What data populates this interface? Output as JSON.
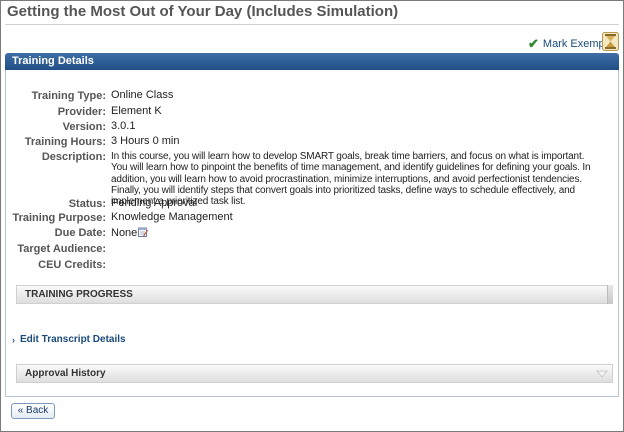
{
  "page": {
    "title": "Getting the Most Out of Your Day (Includes Simulation)"
  },
  "actions": {
    "mark_exempt_label": "Mark Exempt"
  },
  "section": {
    "header": "Training Details"
  },
  "details": [
    {
      "label": "Training Type:",
      "value": "Online Class"
    },
    {
      "label": "Provider:",
      "value": "Element K"
    },
    {
      "label": "Version:",
      "value": "3.0.1"
    },
    {
      "label": "Training Hours:",
      "value": "3 Hours 0 min"
    },
    {
      "label": "Description:",
      "value": "In this course, you will learn how to develop SMART goals, break time barriers, and focus on what is important. You will learn how to pinpoint the benefits of time management, and identify guidelines for defining your goals. In addition, you will learn how to avoid procrastination, minimize interruptions, and avoid perfectionist tendencies. Finally, you will identify steps that convert goals into prioritized tasks, define ways to schedule effectively, and implement a prioritized task list."
    },
    {
      "label": "Status:",
      "value": "Pending Approval"
    },
    {
      "label": "Training Purpose:",
      "value": "Knowledge Management"
    },
    {
      "label": "Due Date:",
      "value": "None"
    },
    {
      "label": "Target Audience:",
      "value": ""
    },
    {
      "label": "CEU Credits:",
      "value": ""
    }
  ],
  "training_progress": {
    "label": "TRAINING PROGRESS"
  },
  "edit_transcript": {
    "label": "Edit Transcript Details"
  },
  "approval_history": {
    "label": "Approval History"
  },
  "back_button": {
    "label": "« Back"
  },
  "icons": {
    "mark_exempt": "check-icon",
    "exempt_status": "hourglass-icon",
    "due_date": "calendar-edit-icon",
    "approval_expand": "chevron-down-icon"
  },
  "colors": {
    "header_bg": "#2a5a92",
    "link": "#1a4a7a",
    "check": "#2e8b2e"
  }
}
